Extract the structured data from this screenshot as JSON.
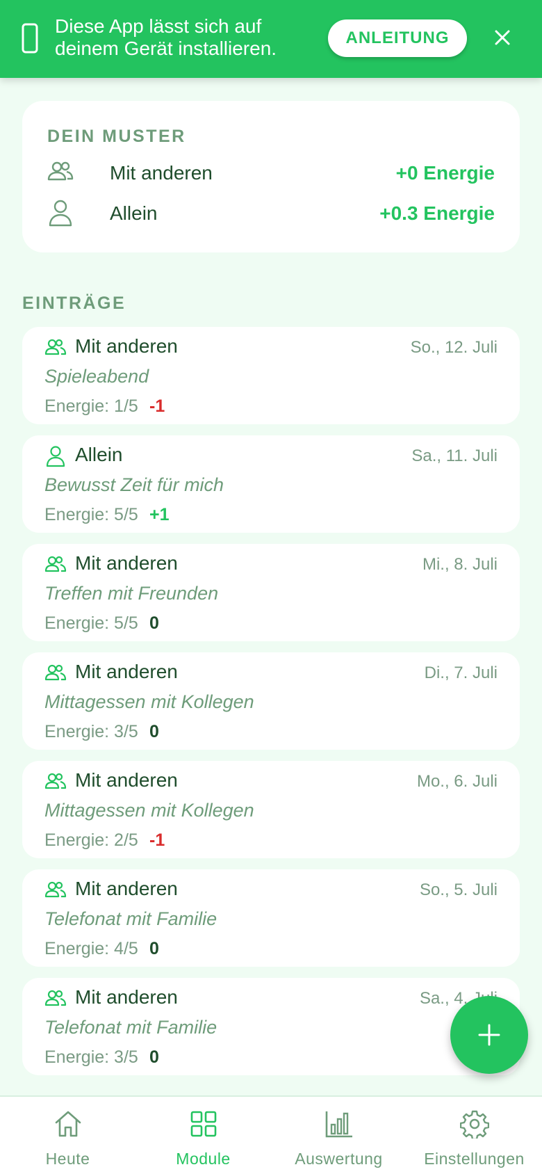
{
  "banner": {
    "message": "Diese App lässt sich auf deinem Gerät installieren.",
    "button_label": "ANLEITUNG",
    "icons": {
      "device": "phone-icon",
      "close": "close-icon"
    }
  },
  "pattern": {
    "title": "DEIN MUSTER",
    "rows": [
      {
        "label": "Mit anderen",
        "value": "+0 Energie",
        "icon": "group-icon"
      },
      {
        "label": "Allein",
        "value": "+0.3 Energie",
        "icon": "person-icon"
      }
    ]
  },
  "entries_title": "EINTRÄGE",
  "entries": [
    {
      "category": "Mit anderen",
      "icon": "group-icon",
      "date": "So., 12. Juli",
      "note": "Spieleabend",
      "energy": "Energie: 1/5",
      "delta": "-1",
      "delta_type": "neg"
    },
    {
      "category": "Allein",
      "icon": "person-icon",
      "date": "Sa., 11. Juli",
      "note": "Bewusst Zeit für mich",
      "energy": "Energie: 5/5",
      "delta": "+1",
      "delta_type": "pos"
    },
    {
      "category": "Mit anderen",
      "icon": "group-icon",
      "date": "Mi., 8. Juli",
      "note": "Treffen mit Freunden",
      "energy": "Energie: 5/5",
      "delta": "0",
      "delta_type": "zero"
    },
    {
      "category": "Mit anderen",
      "icon": "group-icon",
      "date": "Di., 7. Juli",
      "note": "Mittagessen mit Kollegen",
      "energy": "Energie: 3/5",
      "delta": "0",
      "delta_type": "zero"
    },
    {
      "category": "Mit anderen",
      "icon": "group-icon",
      "date": "Mo., 6. Juli",
      "note": "Mittagessen mit Kollegen",
      "energy": "Energie: 2/5",
      "delta": "-1",
      "delta_type": "neg"
    },
    {
      "category": "Mit anderen",
      "icon": "group-icon",
      "date": "So., 5. Juli",
      "note": "Telefonat mit Familie",
      "energy": "Energie: 4/5",
      "delta": "0",
      "delta_type": "zero"
    },
    {
      "category": "Mit anderen",
      "icon": "group-icon",
      "date": "Sa., 4. Juli",
      "note": "Telefonat mit Familie",
      "energy": "Energie: 3/5",
      "delta": "0",
      "delta_type": "zero"
    }
  ],
  "fab": {
    "icon": "plus-icon"
  },
  "nav": {
    "active": "Module",
    "items": [
      {
        "label": "Heute",
        "icon": "home-icon"
      },
      {
        "label": "Module",
        "icon": "grid-icon"
      },
      {
        "label": "Auswertung",
        "icon": "bar-chart-icon"
      },
      {
        "label": "Einstellungen",
        "icon": "gear-icon"
      }
    ]
  },
  "colors": {
    "accent": "#23c35f",
    "background": "#effcf3",
    "negative": "#d92c2c",
    "text_dark": "#1f4d2c",
    "text_muted": "#6e9c7a"
  }
}
